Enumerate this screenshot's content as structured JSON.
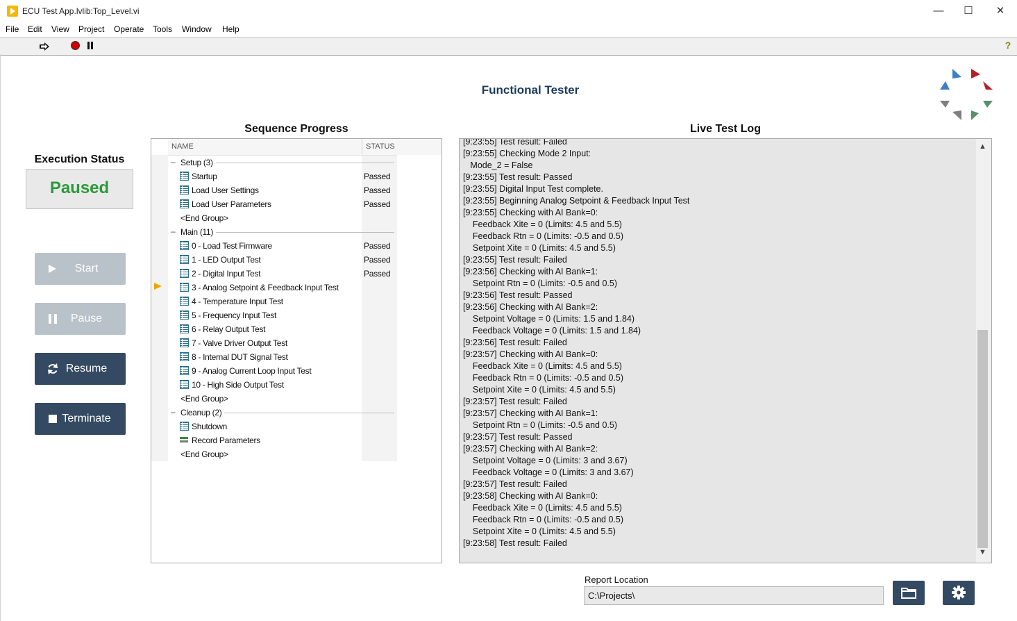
{
  "window": {
    "title": "ECU Test App.lvlib:Top_Level.vi",
    "minimize": "—",
    "maximize": "☐",
    "close": "✕"
  },
  "menu": [
    "File",
    "Edit",
    "View",
    "Project",
    "Operate",
    "Tools",
    "Window",
    "Help"
  ],
  "toolbar": {
    "help_glyph": "?"
  },
  "header": {
    "title": "Functional Tester"
  },
  "execution": {
    "heading": "Execution Status",
    "state": "Paused",
    "state_color": "#2a9a3a"
  },
  "controls": {
    "start": "Start",
    "pause": "Pause",
    "resume": "Resume",
    "terminate": "Terminate"
  },
  "sequence": {
    "heading": "Sequence Progress",
    "col_name": "NAME",
    "col_status": "STATUS",
    "rows": [
      {
        "kind": "group",
        "label": "Setup (3)",
        "status": ""
      },
      {
        "kind": "step",
        "label": "Startup",
        "status": "Passed"
      },
      {
        "kind": "step",
        "label": "Load User Settings",
        "status": "Passed"
      },
      {
        "kind": "step",
        "label": "Load User Parameters",
        "status": "Passed"
      },
      {
        "kind": "end",
        "label": "<End Group>",
        "status": ""
      },
      {
        "kind": "group",
        "label": "Main (11)",
        "status": ""
      },
      {
        "kind": "step",
        "label": "0 - Load Test Firmware",
        "status": "Passed"
      },
      {
        "kind": "step",
        "label": "1 - LED Output Test",
        "status": "Passed"
      },
      {
        "kind": "step",
        "label": "2 - Digital Input Test",
        "status": "Passed"
      },
      {
        "kind": "step",
        "label": "3 - Analog Setpoint & Feedback Input Test",
        "status": "",
        "current": true
      },
      {
        "kind": "step",
        "label": "4 - Temperature Input Test",
        "status": ""
      },
      {
        "kind": "step",
        "label": "5 - Frequency Input Test",
        "status": ""
      },
      {
        "kind": "step",
        "label": "6 - Relay Output Test",
        "status": ""
      },
      {
        "kind": "step",
        "label": "7 - Valve Driver Output Test",
        "status": ""
      },
      {
        "kind": "step",
        "label": "8 - Internal DUT Signal Test",
        "status": ""
      },
      {
        "kind": "step",
        "label": "9 - Analog Current Loop Input Test",
        "status": ""
      },
      {
        "kind": "step",
        "label": "10 - High Side Output Test",
        "status": ""
      },
      {
        "kind": "end",
        "label": "<End Group>",
        "status": ""
      },
      {
        "kind": "group",
        "label": "Cleanup (2)",
        "status": ""
      },
      {
        "kind": "step",
        "label": "Shutdown",
        "status": ""
      },
      {
        "kind": "param",
        "label": "Record Parameters",
        "status": ""
      },
      {
        "kind": "end",
        "label": "<End Group>",
        "status": ""
      }
    ]
  },
  "log": {
    "heading": "Live Test Log",
    "lines": [
      "[9:23:55] Test result: Failed",
      "[9:23:55] Checking Mode 2 Input:",
      "   Mode_2 = False",
      "[9:23:55] Test result: Passed",
      "[9:23:55] Digital Input Test complete.",
      "[9:23:55] Beginning Analog Setpoint & Feedback Input Test",
      "[9:23:55] Checking with AI Bank=0:",
      "    Feedback Xite = 0 (Limits: 4.5 and 5.5)",
      "    Feedback Rtn = 0 (Limits: -0.5 and 0.5)",
      "    Setpoint Xite = 0 (Limits: 4.5 and 5.5)",
      "[9:23:55] Test result: Failed",
      "[9:23:56] Checking with AI Bank=1:",
      "    Setpoint Rtn = 0 (Limits: -0.5 and 0.5)",
      "[9:23:56] Test result: Passed",
      "[9:23:56] Checking with AI Bank=2:",
      "    Setpoint Voltage = 0 (Limits: 1.5 and 1.84)",
      "    Feedback Voltage = 0 (Limits: 1.5 and 1.84)",
      "[9:23:56] Test result: Failed",
      "[9:23:57] Checking with AI Bank=0:",
      "    Feedback Xite = 0 (Limits: 4.5 and 5.5)",
      "    Feedback Rtn = 0 (Limits: -0.5 and 0.5)",
      "    Setpoint Xite = 0 (Limits: 4.5 and 5.5)",
      "[9:23:57] Test result: Failed",
      "[9:23:57] Checking with AI Bank=1:",
      "    Setpoint Rtn = 0 (Limits: -0.5 and 0.5)",
      "[9:23:57] Test result: Passed",
      "[9:23:57] Checking with AI Bank=2:",
      "    Setpoint Voltage = 0 (Limits: 3 and 3.67)",
      "    Feedback Voltage = 0 (Limits: 3 and 3.67)",
      "[9:23:57] Test result: Failed",
      "[9:23:58] Checking with AI Bank=0:",
      "    Feedback Xite = 0 (Limits: 4.5 and 5.5)",
      "    Feedback Rtn = 0 (Limits: -0.5 and 0.5)",
      "    Setpoint Xite = 0 (Limits: 4.5 and 5.5)",
      "[9:23:58] Test result: Failed"
    ]
  },
  "report": {
    "label": "Report Location",
    "path": "C:\\Projects\\"
  },
  "icons": {
    "browse": "folder-icon",
    "settings": "gear-icon"
  },
  "colors": {
    "accent": "#344a63",
    "disabled": "#b9c1c9",
    "title": "#1c3a5c"
  }
}
